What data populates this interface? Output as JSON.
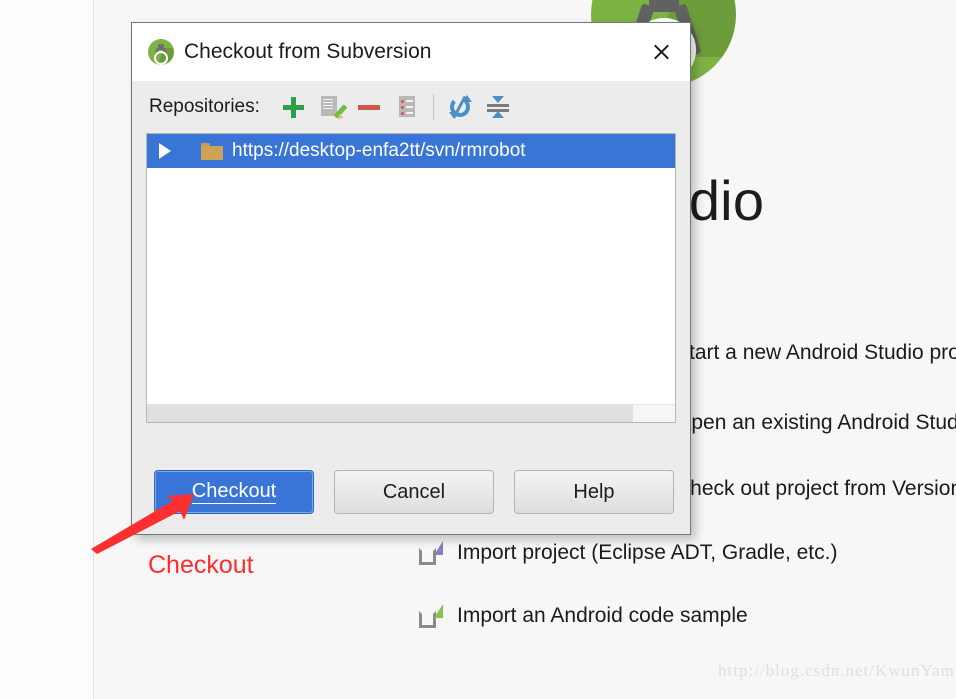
{
  "background": {
    "app_logo_icon": "android-studio-logo",
    "heading": "Android Studio",
    "watermark": "http://blog.csdn.net/KwunYamShan",
    "actions": [
      {
        "label": "Start a new Android Studio project",
        "icon": "new-project-icon",
        "caret": ""
      },
      {
        "label": "Open an existing Android Studio project",
        "icon": "open-project-icon",
        "caret": ""
      },
      {
        "label": "Check out project from Version Control",
        "icon": "vcs-checkout-icon",
        "caret": "chevron-down-icon"
      },
      {
        "label": "Import project (Eclipse ADT, Gradle, etc.)",
        "icon": "import-project-icon",
        "caret": ""
      },
      {
        "label": "Import an Android code sample",
        "icon": "import-sample-icon",
        "caret": ""
      }
    ]
  },
  "dialog": {
    "title": "Checkout from Subversion",
    "title_icon": "android-studio-logo",
    "close_icon": "close-icon",
    "toolbar": {
      "label": "Repositories:",
      "buttons": [
        {
          "name": "add-repository-button",
          "icon": "plus-icon",
          "color": "#2e9e4f"
        },
        {
          "name": "edit-repository-button",
          "icon": "document-edit-icon",
          "color": "#76bb44"
        },
        {
          "name": "remove-repository-button",
          "icon": "minus-icon",
          "color": "#d0564b"
        },
        {
          "name": "repository-details-button",
          "icon": "document-details-icon",
          "color": "#d0564b"
        },
        {
          "name": "refresh-button",
          "icon": "refresh-icon",
          "color": "#4a90c4"
        },
        {
          "name": "collapse-all-button",
          "icon": "collapse-all-icon",
          "color": "#4a90c4"
        }
      ]
    },
    "repositories": [
      {
        "url": "https://desktop-enfa2tt/svn/rmrobot",
        "selected": true,
        "expander": "triangle-right-icon",
        "icon": "folder-icon"
      }
    ],
    "buttons": {
      "checkout": "Checkout",
      "cancel": "Cancel",
      "help": "Help"
    }
  },
  "annotation": {
    "label": "Checkout",
    "color": "#ff2d2d"
  }
}
